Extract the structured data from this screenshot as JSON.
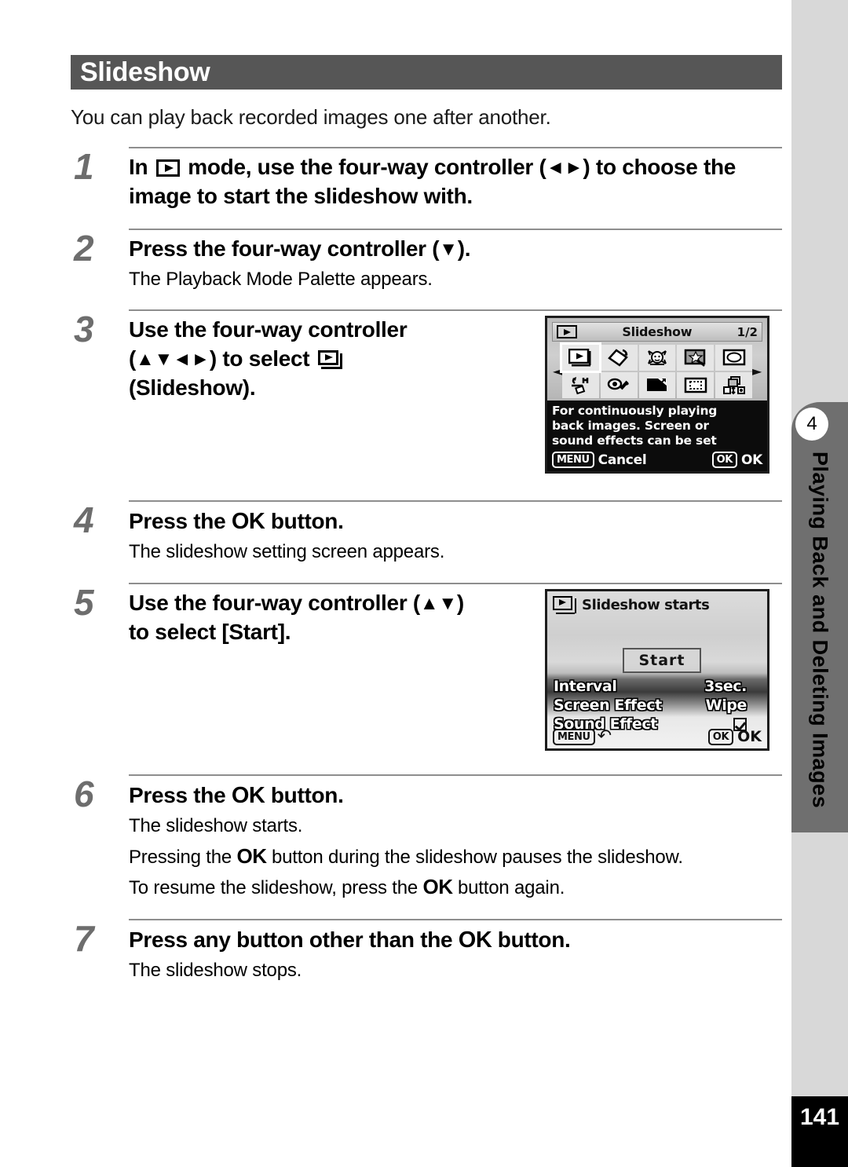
{
  "section": {
    "header_title": "Slideshow",
    "intro": "You can play back recorded images one after another."
  },
  "steps": [
    {
      "number": "1",
      "title_parts": [
        "In ",
        "[playback-icon]",
        " mode, use the four-way controller (◄ ►) to choose the image to start the slideshow with."
      ],
      "title_plain": "In ▶ mode, use the four-way controller (◄ ►) to choose the image to start the slideshow with.",
      "note": ""
    },
    {
      "number": "2",
      "title_plain": "Press the four-way controller (▼).",
      "note": "The Playback Mode Palette appears."
    },
    {
      "number": "3",
      "title_plain": "Use the four-way controller (▲ ▼ ◄ ►) to select ▶ (Slideshow).",
      "title_line1": "Use the four-way controller",
      "title_line2_pre": "(▲▼◄►) to select ",
      "title_line3": "(Slideshow).",
      "note": ""
    },
    {
      "number": "4",
      "title_pre": "Press the ",
      "title_ok": "OK",
      "title_post": " button.",
      "note": "The slideshow setting screen appears."
    },
    {
      "number": "5",
      "title_line1": "Use the four-way controller (▲▼)",
      "title_line2": "to select [Start].",
      "note": ""
    },
    {
      "number": "6",
      "title_pre": "Press the ",
      "title_ok": "OK",
      "title_post": " button.",
      "note1": "The slideshow starts.",
      "note2_pre": "Pressing the ",
      "note2_ok": "OK",
      "note2_post": " button during the slideshow pauses the slideshow.",
      "note3_pre": "To resume the slideshow, press the ",
      "note3_ok": "OK",
      "note3_post": " button again."
    },
    {
      "number": "7",
      "title_pre": "Press any button other than the ",
      "title_ok": "OK",
      "title_post": " button.",
      "note": "The slideshow stops."
    }
  ],
  "palette_screen": {
    "title": "Slideshow",
    "page_indicator": "1/2",
    "caption_line1": "For continuously playing",
    "caption_line2": "back images. Screen or",
    "caption_line3": "sound effects can be set",
    "menu_button": "MENU",
    "menu_label": "Cancel",
    "ok_button": "OK",
    "ok_label": "OK",
    "left_arrow": "◄",
    "right_arrow": "►",
    "icons": [
      "slideshow-icon",
      "image-rotation-icon",
      "small-face-filter-icon",
      "digital-filter-icon",
      "frame-composite-icon",
      "red-eye-compensation-icon",
      "voice-memo-icon",
      "resize-icon",
      "cropping-icon",
      "image-copy-icon"
    ]
  },
  "settings_screen": {
    "header": "Slideshow starts",
    "start_button": "Start",
    "rows": [
      {
        "label": "Interval",
        "value": "3sec."
      },
      {
        "label": "Screen Effect",
        "value": "Wipe"
      },
      {
        "label": "Sound Effect",
        "value": "[checked]"
      }
    ],
    "menu_button": "MENU",
    "ok_button": "OK",
    "ok_label": "OK"
  },
  "sidebar": {
    "chapter_number": "4",
    "chapter_title": "Playing Back and Deleting Images"
  },
  "footer": {
    "page_number": "141"
  },
  "colors": {
    "header_bar": "#565656",
    "side_rail": "#d8d8d8",
    "chapter_tab": "#6f6f6f",
    "step_number": "#6d6d6d",
    "rule": "#8e8e8e"
  }
}
